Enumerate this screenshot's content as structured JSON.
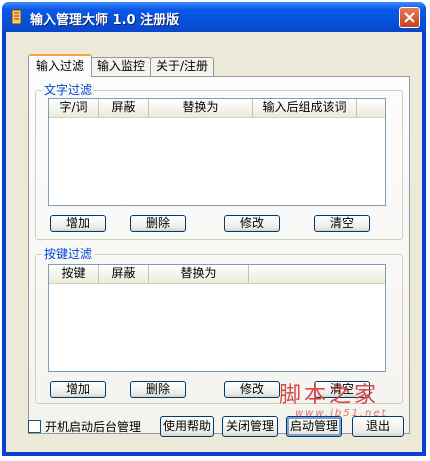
{
  "window": {
    "title": "输入管理大师 1.0 注册版",
    "titlebar_color": "#0a58e8"
  },
  "tabs": [
    {
      "label": "输入过滤",
      "active": true
    },
    {
      "label": "输入监控",
      "active": false
    },
    {
      "label": "关于/注册",
      "active": false
    }
  ],
  "text_filter": {
    "title": "文字过滤",
    "columns": [
      "字/词",
      "屏蔽",
      "替换为",
      "输入后组成该词"
    ],
    "rows": [],
    "buttons": {
      "add": "增加",
      "delete": "删除",
      "modify": "修改",
      "clear": "清空"
    }
  },
  "key_filter": {
    "title": "按键过滤",
    "columns": [
      "按键",
      "屏蔽",
      "替换为"
    ],
    "rows": [],
    "buttons": {
      "add": "增加",
      "delete": "删除",
      "modify": "修改",
      "clear": "清空"
    }
  },
  "footer": {
    "autostart_label": "开机启动后台管理",
    "autostart_checked": false,
    "help": "使用帮助",
    "stop": "关闭管理",
    "start": "启动管理",
    "exit": "退出"
  },
  "watermark": {
    "text": "脚本之家",
    "url": "www.jb51.net"
  },
  "icons": {
    "app": "pencil-icon",
    "close": "close-icon"
  }
}
